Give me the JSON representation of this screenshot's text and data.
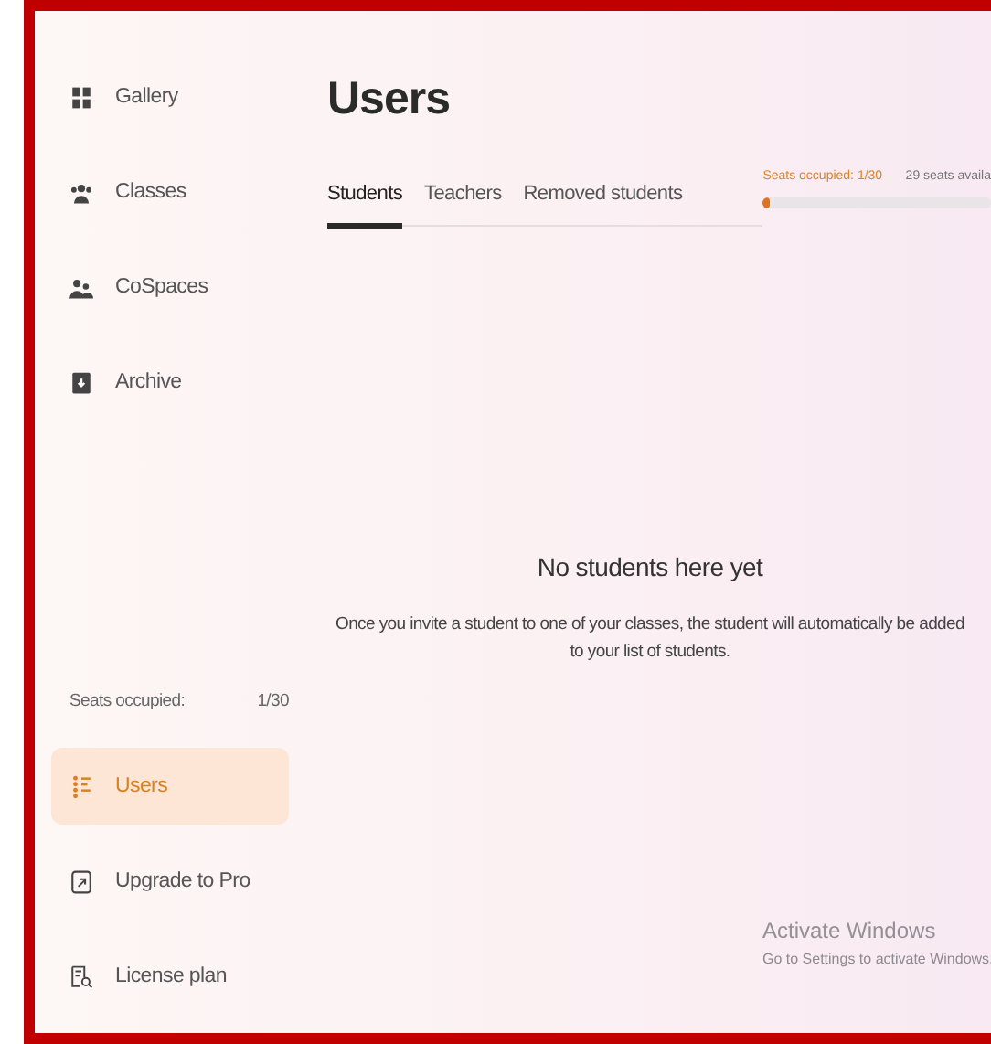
{
  "sidebar": {
    "items": [
      {
        "kind": "gallery",
        "label": "Gallery",
        "selected": false
      },
      {
        "kind": "classes",
        "label": "Classes",
        "selected": false
      },
      {
        "kind": "cospaces",
        "label": "CoSpaces",
        "selected": false
      },
      {
        "kind": "archive",
        "label": "Archive",
        "selected": false
      }
    ],
    "seats": {
      "label": "Seats occupied:",
      "value": "1/30"
    },
    "bottom_items": [
      {
        "kind": "users",
        "label": "Users",
        "selected": true
      },
      {
        "kind": "upgrade",
        "label": "Upgrade to Pro",
        "selected": false
      },
      {
        "kind": "license",
        "label": "License plan",
        "selected": false
      }
    ]
  },
  "page": {
    "title": "Users",
    "tabs": [
      {
        "label": "Students",
        "selected": true
      },
      {
        "label": "Teachers",
        "selected": false
      },
      {
        "label": "Removed students",
        "selected": false
      }
    ],
    "seats_meter": {
      "label": "Seats occupied: 1/30",
      "available": "29 seats availa",
      "level": 0.033
    },
    "empty_state": {
      "title": "No students here yet",
      "text": "Once you invite a student to one of your classes, the student will automatically be added to your list of students."
    }
  },
  "os_notice": {
    "title": "Activate Windows",
    "text": "Go to Settings to activate Windows."
  }
}
